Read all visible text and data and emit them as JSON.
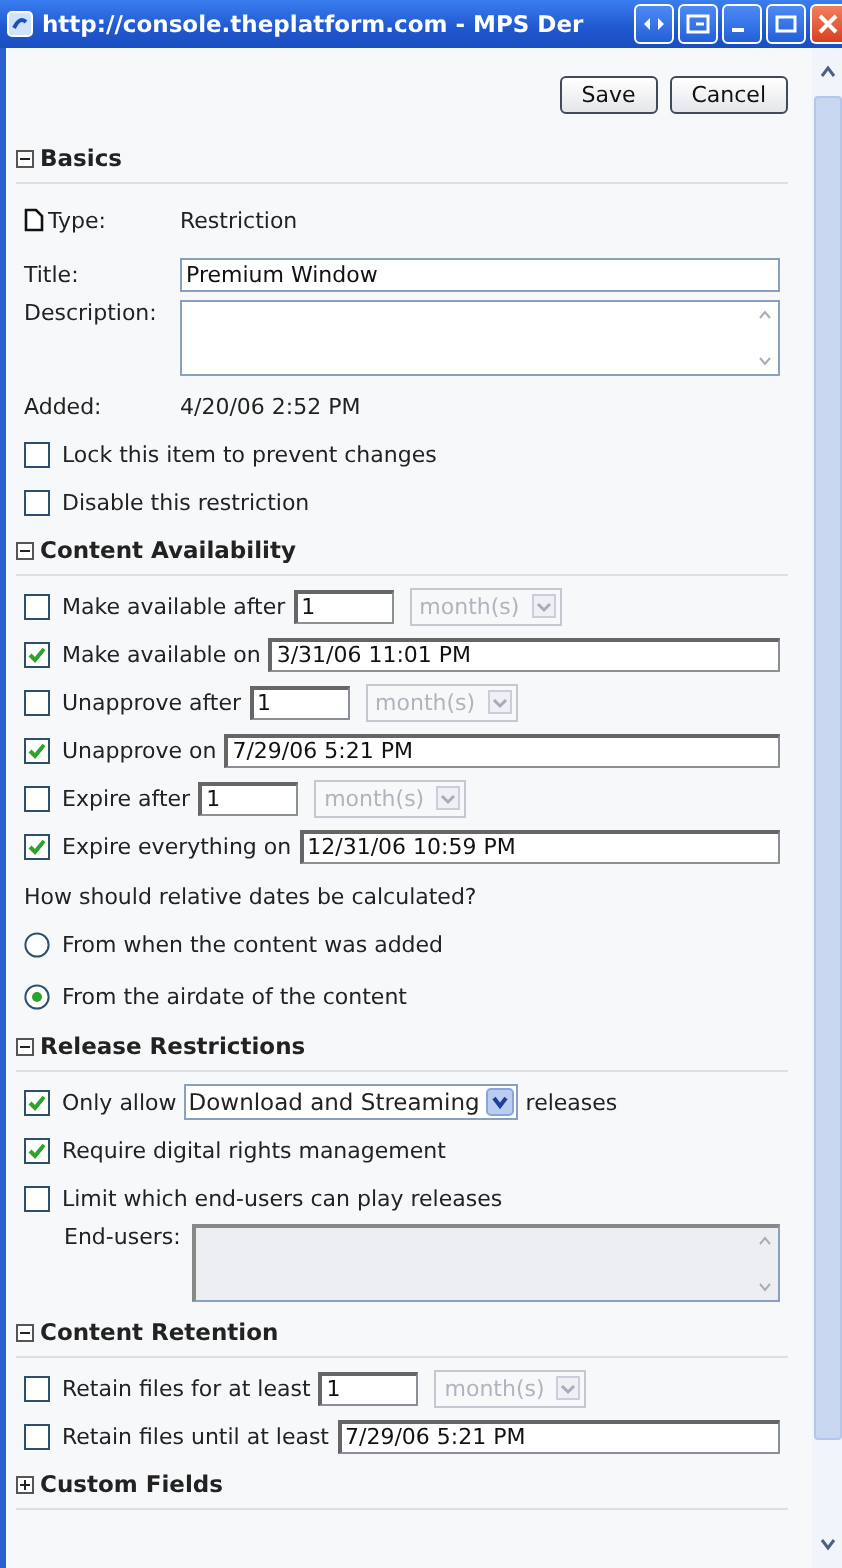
{
  "window": {
    "title": "http://console.theplatform.com - MPS Der"
  },
  "buttons": [
    "Save",
    "Cancel"
  ],
  "sections": [
    {
      "title": "Basics",
      "expanded": true,
      "rows": [
        {
          "kind": "info",
          "label": "Type:",
          "value": "Restriction",
          "doc_icon": true
        },
        {
          "kind": "field",
          "label": "Title:",
          "value": "Premium Window"
        },
        {
          "kind": "textarea",
          "label": "Description:",
          "disabled": false
        },
        {
          "kind": "info",
          "label": "Added:",
          "value": "4/20/06 2:52 PM"
        },
        {
          "kind": "check",
          "checked": false,
          "label": "Lock this item to prevent changes"
        },
        {
          "kind": "check",
          "checked": false,
          "label": "Disable this restriction"
        }
      ]
    },
    {
      "title": "Content Availability",
      "expanded": true,
      "rows": [
        {
          "kind": "check",
          "checked": false,
          "label": "Make available after",
          "number": "1",
          "unit": {
            "value": "month(s)",
            "disabled": true
          }
        },
        {
          "kind": "check",
          "checked": true,
          "label": "Make available on",
          "date": "3/31/06 11:01 PM"
        },
        {
          "kind": "check",
          "checked": false,
          "label": "Unapprove after",
          "number": "1",
          "unit": {
            "value": "month(s)",
            "disabled": true
          }
        },
        {
          "kind": "check",
          "checked": true,
          "label": "Unapprove on",
          "date": "7/29/06 5:21 PM"
        },
        {
          "kind": "check",
          "checked": false,
          "label": "Expire after",
          "number": "1",
          "unit": {
            "value": "month(s)",
            "disabled": true
          }
        },
        {
          "kind": "check",
          "checked": true,
          "label": "Expire everything on",
          "date": "12/31/06 10:59 PM"
        },
        {
          "kind": "question",
          "text": "How should relative dates be calculated?"
        },
        {
          "kind": "radio",
          "selected": false,
          "label": "From when the content was added"
        },
        {
          "kind": "radio",
          "selected": true,
          "label": "From the airdate of the content"
        }
      ]
    },
    {
      "title": "Release Restrictions",
      "expanded": true,
      "rows": [
        {
          "kind": "check",
          "checked": true,
          "label": "Only allow",
          "select": "Download and Streaming",
          "suffix": "releases"
        },
        {
          "kind": "check",
          "checked": true,
          "label": "Require digital rights management"
        },
        {
          "kind": "check",
          "checked": false,
          "label": "Limit which end-users can play releases"
        },
        {
          "kind": "textarea",
          "label": "End-users:",
          "disabled": true
        }
      ]
    },
    {
      "title": "Content Retention",
      "expanded": true,
      "rows": [
        {
          "kind": "check",
          "checked": false,
          "label": "Retain files for at least",
          "number": "1",
          "unit": {
            "value": "month(s)",
            "disabled": true
          }
        },
        {
          "kind": "check",
          "checked": false,
          "label": "Retain files until at least",
          "date": "7/29/06 5:21 PM"
        }
      ]
    },
    {
      "title": "Custom Fields",
      "expanded": false
    }
  ]
}
